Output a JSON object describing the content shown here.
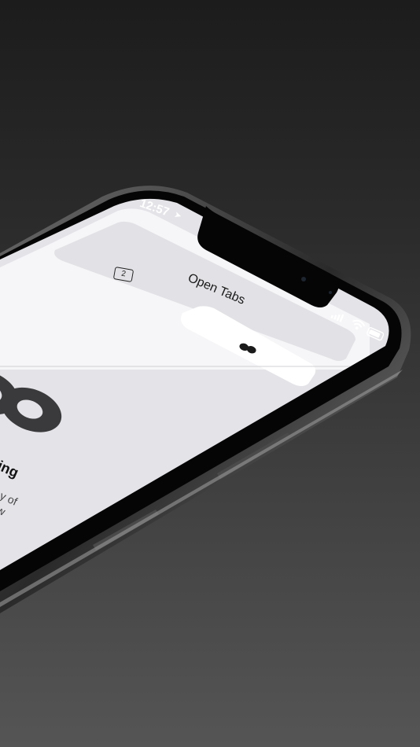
{
  "status_bar": {
    "time": "12:57",
    "location_icon": "location-arrow-icon",
    "signal_icon": "cellular-signal-icon",
    "wifi_icon": "wifi-icon",
    "battery_icon": "battery-icon"
  },
  "header": {
    "title": "Open Tabs",
    "tab_count": "2"
  },
  "segmented_control": {
    "private_icon": "mask-icon"
  },
  "content": {
    "headline_fragment": "ing",
    "body_line_1": "y of",
    "body_line_2": "w",
    "hero_icon": "mask-icon"
  },
  "colors": {
    "background_top": "#1c1c1c",
    "background_bottom": "#555555",
    "screen_bg": "#e4e3e8",
    "nav_bg": "#f6f6f8",
    "segment_selected": "#ffffff",
    "icon_dark": "#3a3a3c"
  }
}
